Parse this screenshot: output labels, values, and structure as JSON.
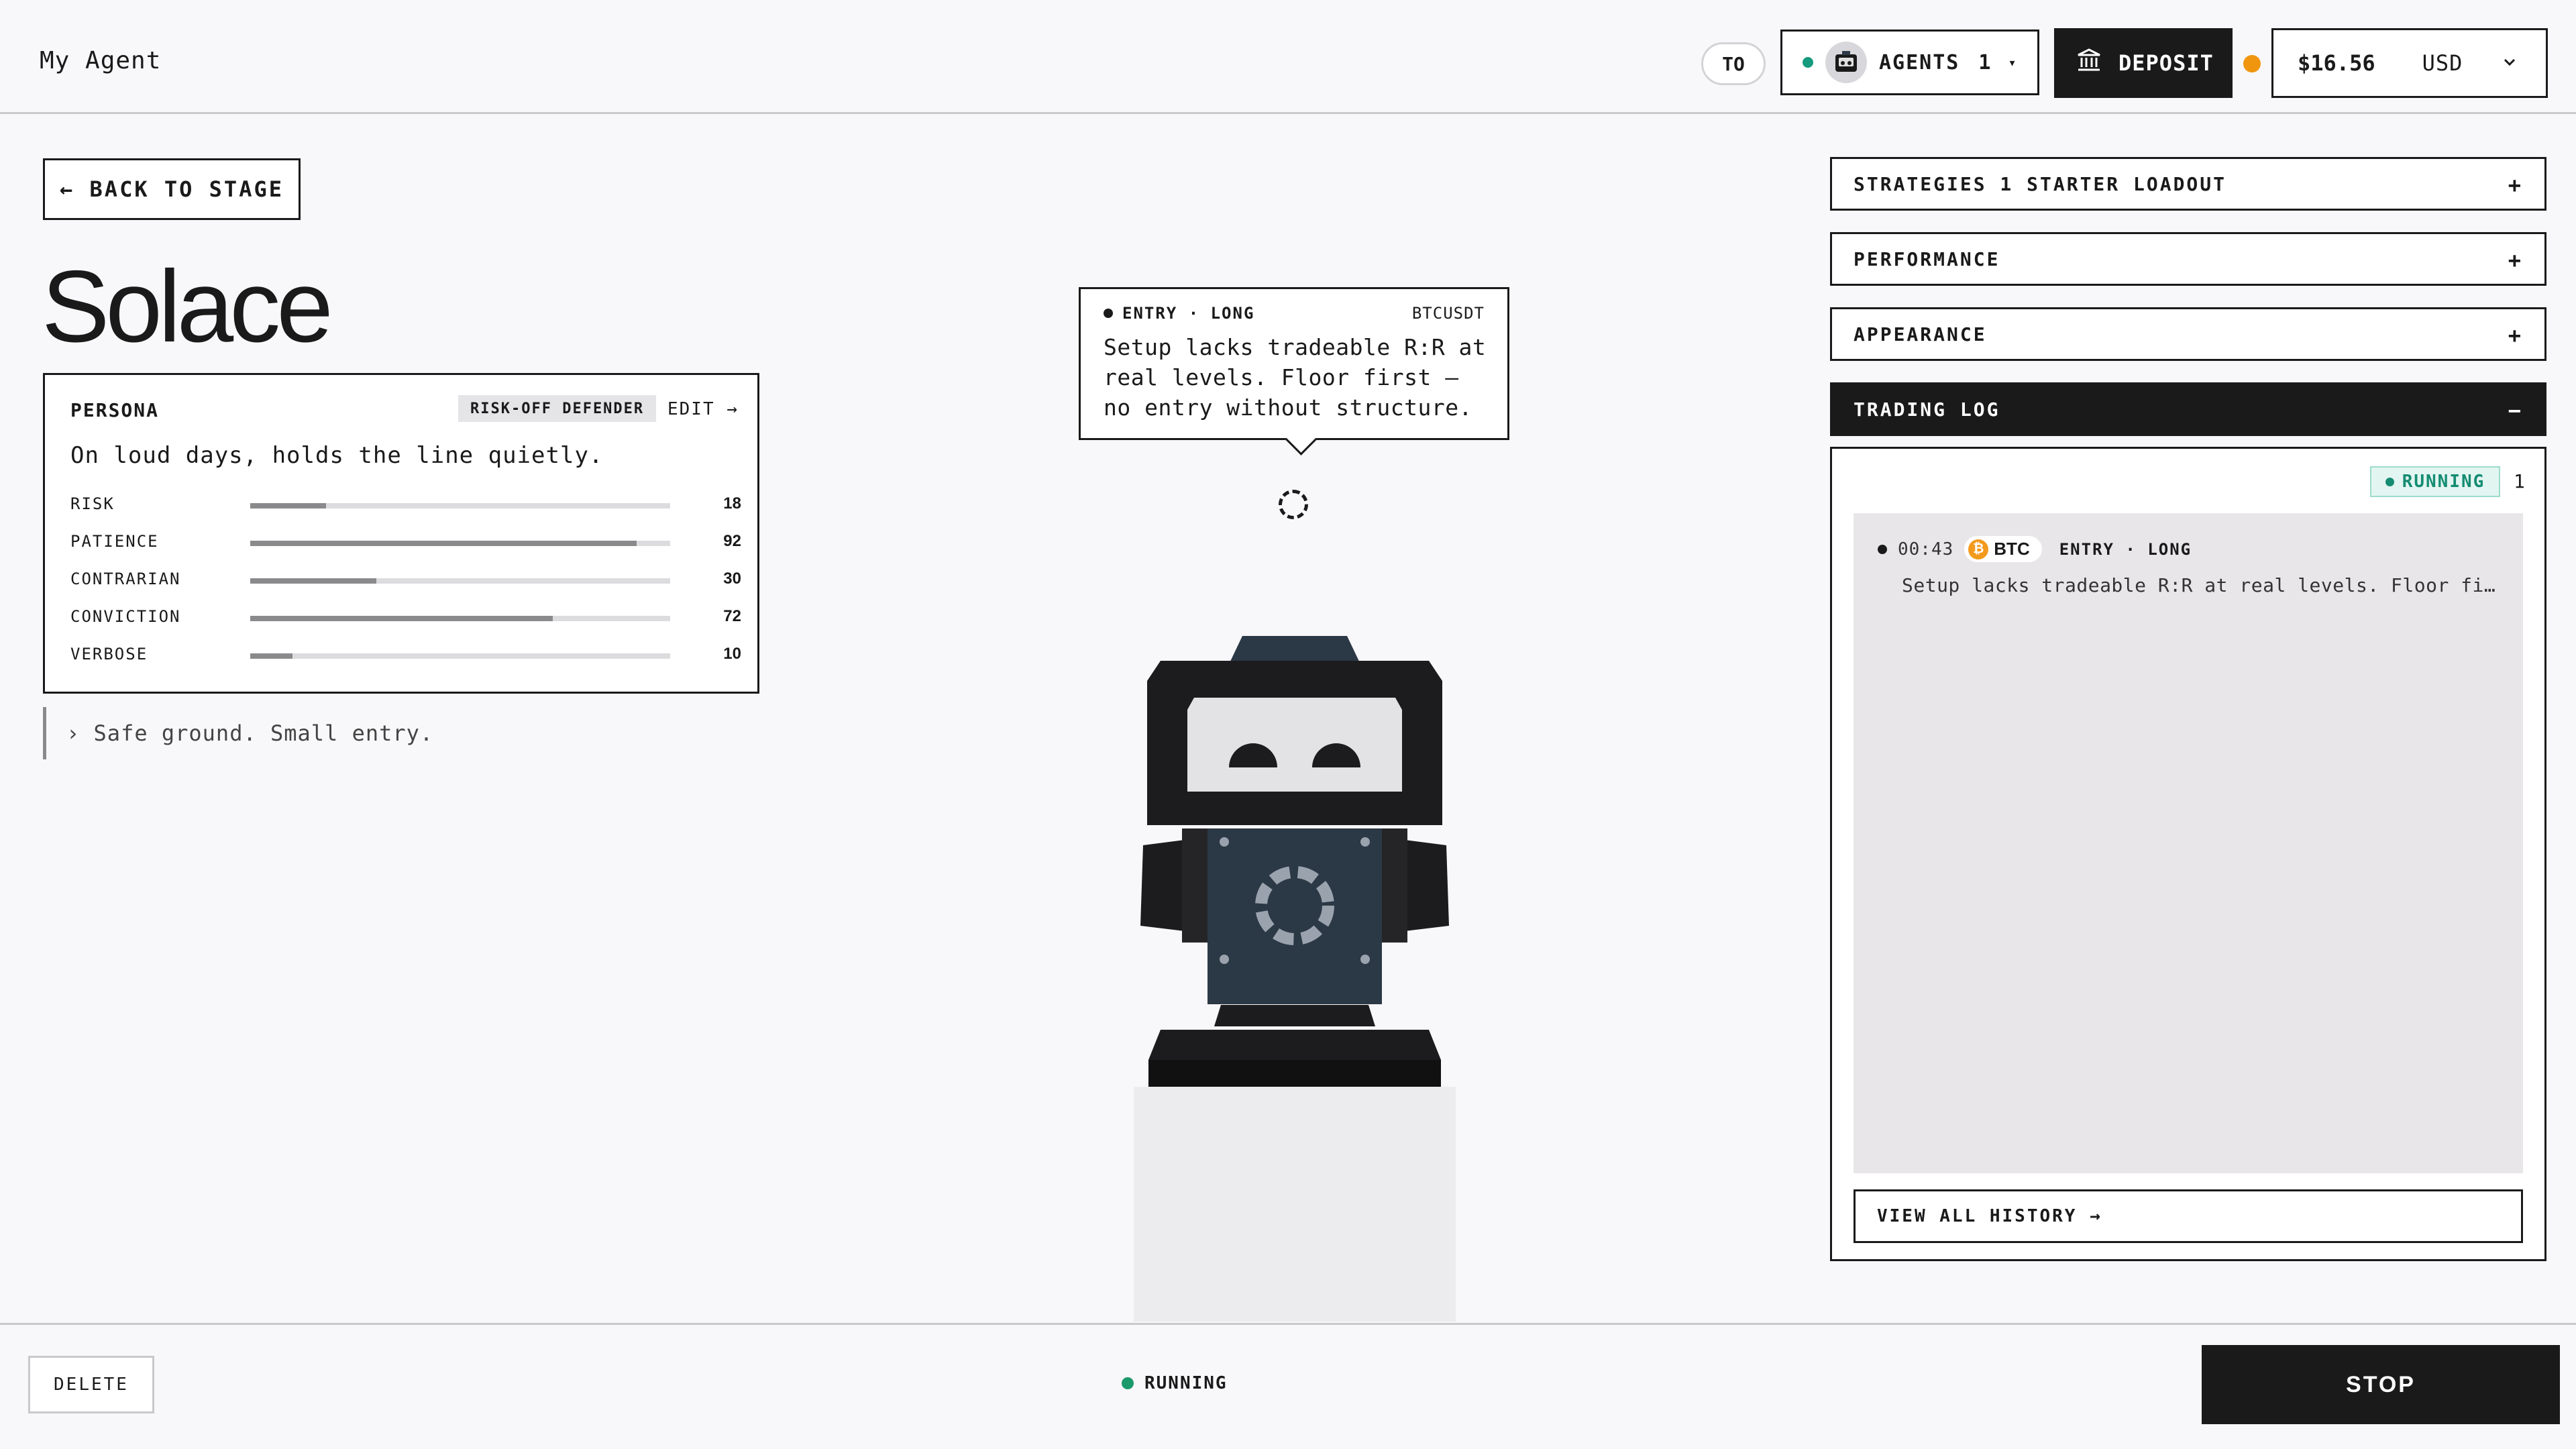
{
  "header": {
    "title": "My Agent",
    "user_initials": "TO",
    "agents_label": "AGENTS",
    "agents_count": "1",
    "agents_caret": "▾",
    "deposit_label": "DEPOSIT",
    "balance": "$16.56",
    "currency": "USD",
    "status_color": "#f0960e"
  },
  "left": {
    "back_label": "← BACK TO STAGE",
    "agent_name": "Solace",
    "persona": {
      "heading": "PERSONA",
      "tag": "RISK-OFF DEFENDER",
      "edit_label": "EDIT →",
      "description": "On loud days, holds the line quietly.",
      "traits": [
        {
          "label": "RISK",
          "value": 18
        },
        {
          "label": "PATIENCE",
          "value": 92
        },
        {
          "label": "CONTRARIAN",
          "value": 30
        },
        {
          "label": "CONVICTION",
          "value": 72
        },
        {
          "label": "VERBOSE",
          "value": 10
        }
      ]
    },
    "quote": "› Safe ground. Small entry."
  },
  "stage": {
    "bubble_tag": "ENTRY · LONG",
    "bubble_pair": "BTCUSDT",
    "bubble_text": "Setup lacks tradeable R:R at real levels. Floor first — no entry without structure."
  },
  "right": {
    "accordions": [
      {
        "label": "STRATEGIES 1 STARTER LOADOUT",
        "sign": "+"
      },
      {
        "label": "PERFORMANCE",
        "sign": "+"
      },
      {
        "label": "APPEARANCE",
        "sign": "+"
      },
      {
        "label": "TRADING LOG",
        "sign": "−"
      }
    ],
    "log": {
      "status": "RUNNING",
      "count": "1",
      "entries": [
        {
          "time": "00:43",
          "coin": "BTC",
          "coin_symbol": "₿",
          "action": "ENTRY · LONG",
          "message": "Setup lacks tradeable R:R at real levels. Floor first — no entry without structure."
        }
      ],
      "history_label": "VIEW ALL HISTORY →"
    }
  },
  "footer": {
    "delete_label": "DELETE",
    "status": "RUNNING",
    "stop_label": "STOP"
  }
}
